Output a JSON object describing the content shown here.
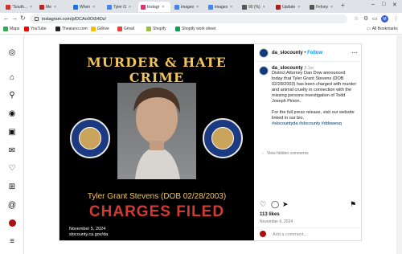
{
  "browser": {
    "tabs": [
      {
        "label": "\"South...",
        "color": "#d93025"
      },
      {
        "label": "Me",
        "color": "#c5221f"
      },
      {
        "label": "When",
        "color": "#1a73e8"
      },
      {
        "label": "Tyler G",
        "color": "#4285f4"
      },
      {
        "label": "Instagr",
        "color": "#e1306c"
      },
      {
        "label": "images",
        "color": "#4285f4"
      },
      {
        "label": "images",
        "color": "#4285f4"
      },
      {
        "label": "90 (%)",
        "color": "#555555"
      },
      {
        "label": "Update",
        "color": "#b31b1b"
      },
      {
        "label": "Felony",
        "color": "#555555"
      }
    ],
    "url": "instagram.com/p/DCAo0Ot54Dz/",
    "profile_initial": "M",
    "bookmarks": [
      {
        "label": "Maps",
        "color": "#34a853"
      },
      {
        "label": "YouTube",
        "color": "#ff0000"
      },
      {
        "label": "Theaiuno.com",
        "color": "#222222"
      },
      {
        "label": "Gdrive",
        "color": "#fbbc04"
      },
      {
        "label": "Gmail",
        "color": "#ea4335"
      },
      {
        "label": "Shopify",
        "color": "#95bf47"
      },
      {
        "label": "Shopify work sheet",
        "color": "#0f9d58"
      }
    ],
    "all_bookmarks": "All Bookmarks"
  },
  "post": {
    "image": {
      "title": "MURDER & HATE CRIME",
      "name_line": "Tyler Grant Stevens (DOB 02/28/2003)",
      "banner": "CHARGES FILED",
      "date": "November 5, 2024",
      "site": "slocounty.ca.gov/da",
      "seal_text": "DISTRICT ATTORNEY · COUNTY OF SAN LUIS OBISPO"
    },
    "account": "da_slocounty",
    "follow_label": "Follow",
    "separator": "•",
    "comment": {
      "author": "da_slocounty",
      "age": "3.1w",
      "text": "District Attorney Dan Dow announced today that Tyler Grant Stevens (DOB 02/28/2003) has been charged with murder and animal cruelty in connection with the missing persons investigation of Todd Joseph Pinion.",
      "more": "For the full press release, visit our website linked in our bio.",
      "hashtags": "#slocountyda #slocounty #ddowesq"
    },
    "view_hidden": "View hidden comments",
    "likes": "113 likes",
    "date": "November 6, 2024",
    "comment_placeholder": "Add a comment..."
  }
}
